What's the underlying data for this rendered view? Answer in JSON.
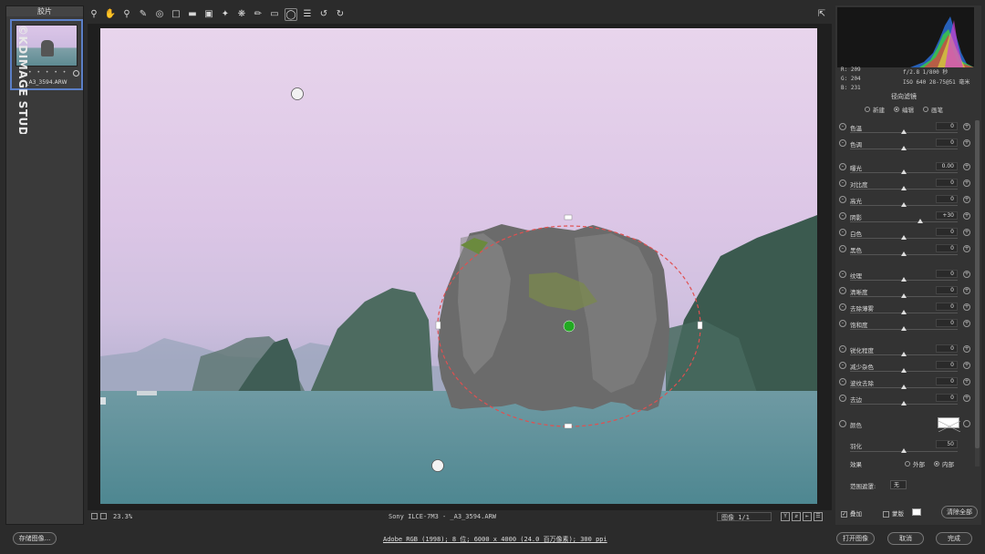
{
  "filmstrip": {
    "title": "胶片",
    "thumb_name": "_A3_3594.ARW",
    "rating": "• • • • •"
  },
  "watermark": "©KDIMAGE STUDIO",
  "toolbar": {
    "icons": [
      "zoom-icon",
      "hand-icon",
      "white-balance-icon",
      "color-sampler-icon",
      "target-adjust-icon",
      "crop-icon",
      "straighten-icon",
      "transform-icon",
      "spot-removal-icon",
      "red-eye-icon",
      "adjustment-brush-icon",
      "graduated-filter-icon",
      "radial-filter-icon",
      "presets-icon",
      "rotate-left-icon",
      "rotate-right-icon"
    ]
  },
  "canvas": {
    "zoom": "23.3%",
    "filename": "Sony ILCE-7M3 -  _A3_3594.ARW",
    "image_nav": "图像 1/1"
  },
  "status": {
    "save_label": "存储图像...",
    "workflow_link": "Adobe RGB (1998); 8 位; 6000 x 4000 (24.0 百万像素); 300 ppi",
    "open_label": "打开图像",
    "cancel_label": "取消",
    "done_label": "完成"
  },
  "panel": {
    "rgb": {
      "r": "R:   209",
      "g": "G:   204",
      "b": "B:   231"
    },
    "camera": {
      "line1": "f/2.8   1/800 秒",
      "line2": "ISO 640   28-75@51 毫米"
    },
    "title": "径向滤镜",
    "modes": [
      {
        "label": "新建",
        "on": false
      },
      {
        "label": "编辑",
        "on": true
      },
      {
        "label": "画笔",
        "on": false
      }
    ],
    "sliders": [
      {
        "label": "色温",
        "value": "0",
        "pos": 0.5
      },
      {
        "label": "色调",
        "value": "0",
        "pos": 0.5
      },
      {
        "label": "曝光",
        "value": "0.00",
        "pos": 0.5
      },
      {
        "label": "对比度",
        "value": "0",
        "pos": 0.5
      },
      {
        "label": "高光",
        "value": "0",
        "pos": 0.5
      },
      {
        "label": "阴影",
        "value": "+30",
        "pos": 0.65
      },
      {
        "label": "白色",
        "value": "0",
        "pos": 0.5
      },
      {
        "label": "黑色",
        "value": "0",
        "pos": 0.5
      },
      {
        "label": "纹理",
        "value": "0",
        "pos": 0.5
      },
      {
        "label": "清晰度",
        "value": "0",
        "pos": 0.5
      },
      {
        "label": "去除薄雾",
        "value": "0",
        "pos": 0.5
      },
      {
        "label": "饱和度",
        "value": "0",
        "pos": 0.5
      },
      {
        "label": "锐化程度",
        "value": "0",
        "pos": 0.5
      },
      {
        "label": "减少杂色",
        "value": "0",
        "pos": 0.5
      },
      {
        "label": "波纹去除",
        "value": "0",
        "pos": 0.5
      },
      {
        "label": "去边",
        "value": "0",
        "pos": 0.5
      }
    ],
    "color_label": "颜色",
    "feather_label": "羽化",
    "feather_value": "50",
    "feather_pos": 0.5,
    "effect_label": "效果",
    "effect_outside": "外部",
    "effect_inside": "内部",
    "range_label": "范围遮罩:",
    "range_value": "无",
    "overlay_label": "叠加",
    "mask_label": "蒙版",
    "clear_label": "清除全部"
  }
}
